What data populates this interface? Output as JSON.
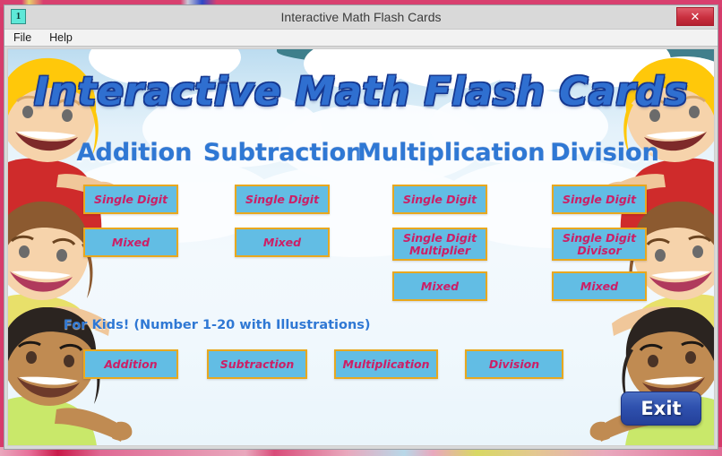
{
  "desktop": {
    "background_color": "#d63b6b"
  },
  "window": {
    "title": "Interactive Math Flash Cards",
    "icon_label": "1",
    "close_label": "✕",
    "accent_colors": {
      "button_fill": "#62bde4",
      "button_border": "#e8a81e",
      "button_text": "#cc1f66",
      "heading_text": "#2f78d4",
      "title_text": "#2f6fd0",
      "exit_fill": "#2f51ae",
      "close_fill": "#c9303f"
    }
  },
  "menubar": {
    "items": [
      {
        "label": "File"
      },
      {
        "label": "Help"
      }
    ]
  },
  "app": {
    "title": "Interactive Math Flash Cards",
    "for_kids_label": "For Kids! (Number 1-20 with Illustrations)",
    "exit_label": "Exit",
    "columns": [
      {
        "heading": "Addition",
        "buttons": [
          {
            "label": "Single Digit"
          },
          {
            "label": "Mixed"
          }
        ]
      },
      {
        "heading": "Subtraction",
        "buttons": [
          {
            "label": "Single Digit"
          },
          {
            "label": "Mixed"
          }
        ]
      },
      {
        "heading": "Multiplication",
        "buttons": [
          {
            "label": "Single Digit"
          },
          {
            "label": "Single Digit\nMultiplier"
          },
          {
            "label": "Mixed"
          }
        ]
      },
      {
        "heading": "Division",
        "buttons": [
          {
            "label": "Single Digit"
          },
          {
            "label": "Single Digit\nDivisor"
          },
          {
            "label": "Mixed"
          }
        ]
      }
    ],
    "kids_buttons": [
      {
        "label": "Addition"
      },
      {
        "label": "Subtraction"
      },
      {
        "label": "Multiplication"
      },
      {
        "label": "Division"
      }
    ]
  }
}
